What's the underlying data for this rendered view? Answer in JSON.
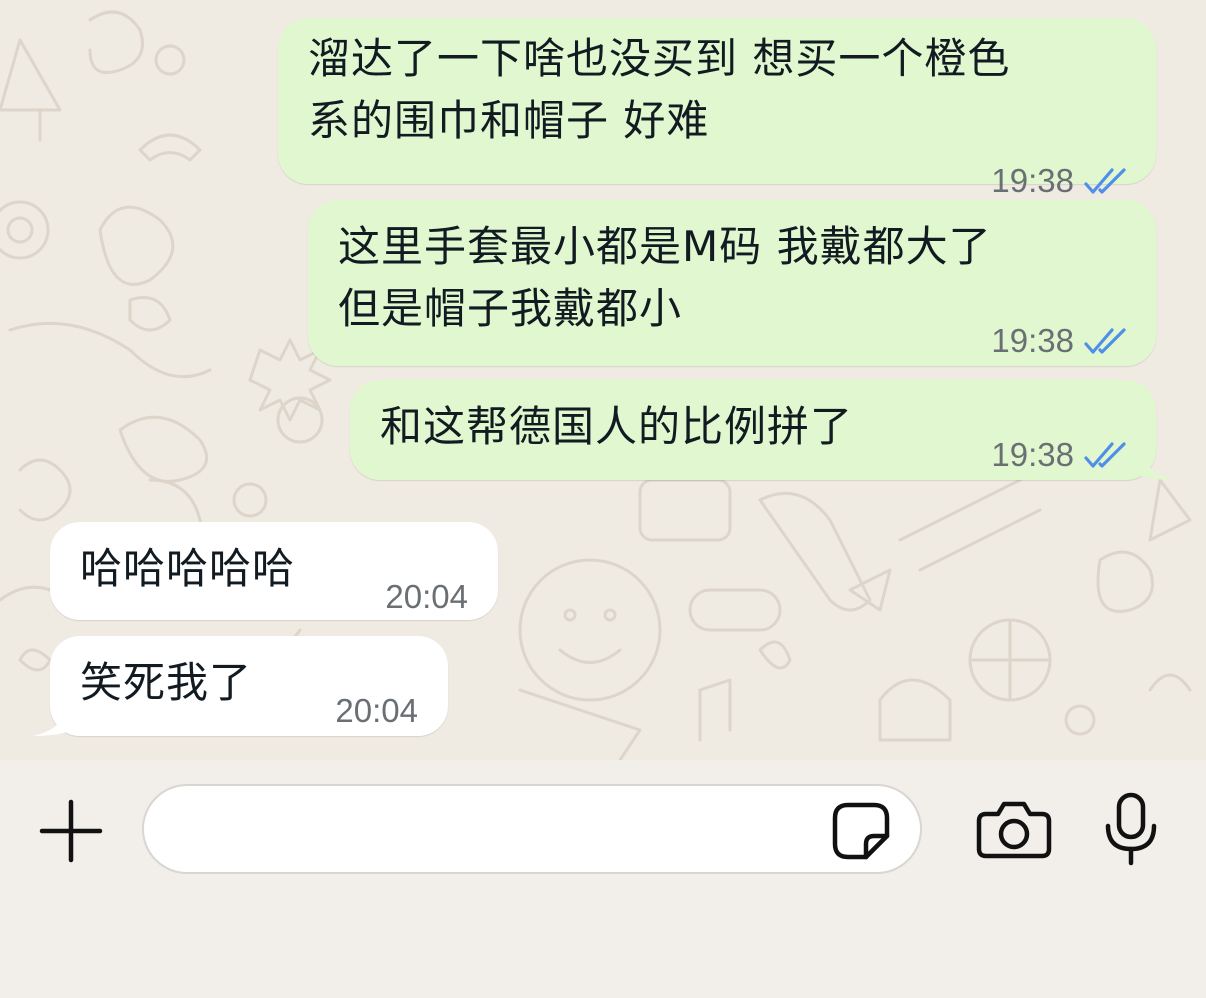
{
  "colors": {
    "outgoing_bubble": "#e1f7cf",
    "incoming_bubble": "#ffffff",
    "chat_background": "#efeae2",
    "read_ticks": "#4f8fe8",
    "timestamp": "#6a6f74"
  },
  "messages": [
    {
      "direction": "outgoing",
      "text": "溜达了一下啥也没买到 想买一个橙色\n系的围巾和帽子 好难",
      "time": "19:38",
      "status": "read"
    },
    {
      "direction": "outgoing",
      "text": "这里手套最小都是M码 我戴都大了\n但是帽子我戴都小",
      "time": "19:38",
      "status": "read"
    },
    {
      "direction": "outgoing",
      "text": "和这帮德国人的比例拼了",
      "time": "19:38",
      "status": "read"
    },
    {
      "direction": "incoming",
      "text": "哈哈哈哈哈",
      "time": "20:04"
    },
    {
      "direction": "incoming",
      "text": "笑死我了",
      "time": "20:04"
    }
  ],
  "composer": {
    "placeholder": "",
    "value": "",
    "icons": [
      "plus-icon",
      "sticker-icon",
      "camera-icon",
      "microphone-icon"
    ]
  }
}
